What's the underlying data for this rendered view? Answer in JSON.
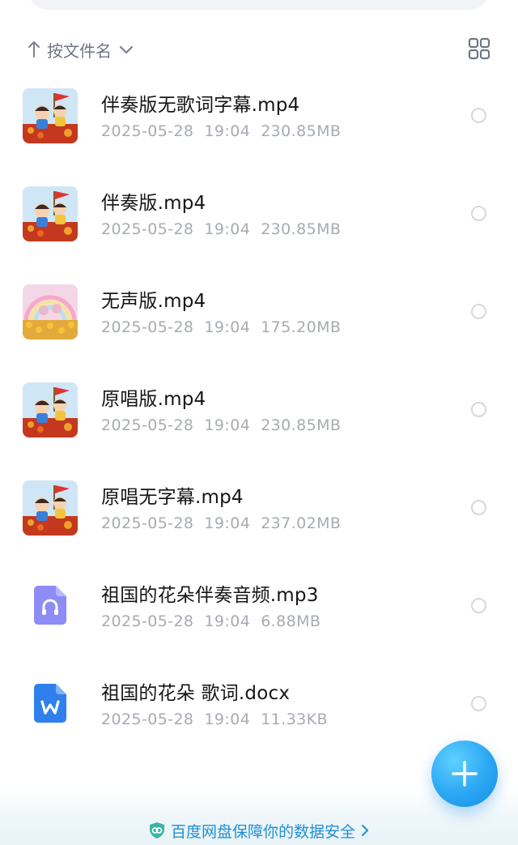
{
  "sort": {
    "label": "按文件名",
    "direction": "ascending"
  },
  "view_toggle": {
    "icon": "grid-view-icon"
  },
  "files": [
    {
      "name": "伴奏版无歌词字幕.mp4",
      "date": "2025-05-28",
      "time": "19:04",
      "size": "230.85MB",
      "type": "video",
      "thumb": "thumb-kids-flag"
    },
    {
      "name": "伴奏版.mp4",
      "date": "2025-05-28",
      "time": "19:04",
      "size": "230.85MB",
      "type": "video",
      "thumb": "thumb-kids-flag"
    },
    {
      "name": "无声版.mp4",
      "date": "2025-05-28",
      "time": "19:04",
      "size": "175.20MB",
      "type": "video",
      "thumb": "thumb-rainbow-flowers"
    },
    {
      "name": "原唱版.mp4",
      "date": "2025-05-28",
      "time": "19:04",
      "size": "230.85MB",
      "type": "video",
      "thumb": "thumb-kids-flag"
    },
    {
      "name": "原唱无字幕.mp4",
      "date": "2025-05-28",
      "time": "19:04",
      "size": "237.02MB",
      "type": "video",
      "thumb": "thumb-kids-flag"
    },
    {
      "name": "祖国的花朵伴奏音频.mp3",
      "date": "2025-05-28",
      "time": "19:04",
      "size": "6.88MB",
      "type": "audio",
      "thumb": "audio-file-icon"
    },
    {
      "name": "祖国的花朵 歌词.docx",
      "date": "2025-05-28",
      "time": "19:04",
      "size": "11.33KB",
      "type": "word",
      "thumb": "word-file-icon"
    }
  ],
  "footer": {
    "security_text": "百度网盘保障你的数据安全"
  },
  "colors": {
    "accent": "#2aa6f3",
    "security_text": "#1e8fd7",
    "meta_text": "#a7abb3",
    "audio_icon": "#8e8cf6",
    "word_icon": "#2f80ed"
  }
}
